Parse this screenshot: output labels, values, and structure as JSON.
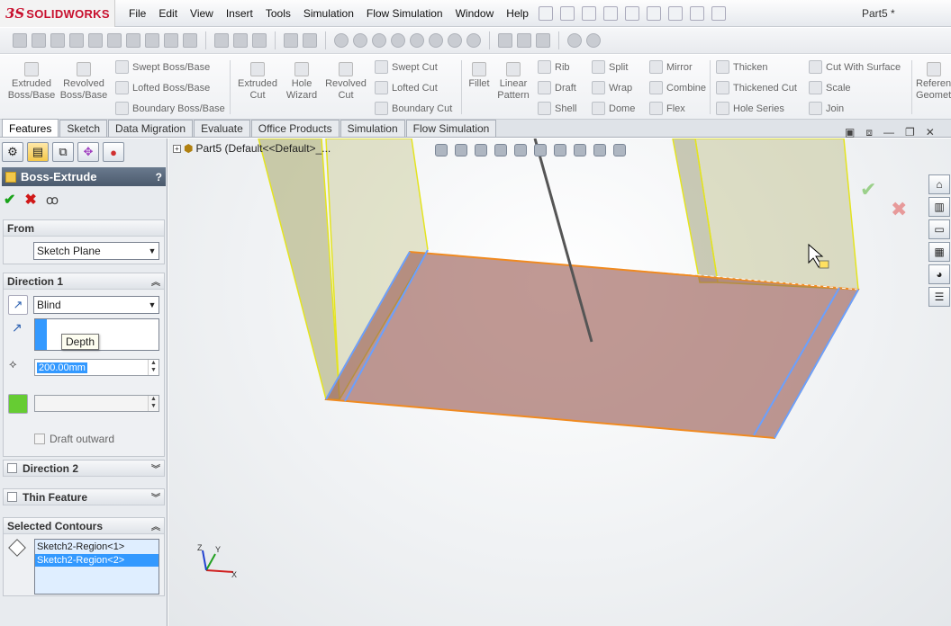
{
  "app": {
    "brand_ds": "3S",
    "brand_name": "SOLIDWORKS",
    "document_title": "Part5 *"
  },
  "menu": [
    "File",
    "Edit",
    "View",
    "Insert",
    "Tools",
    "Simulation",
    "Flow Simulation",
    "Window",
    "Help"
  ],
  "ribbon": {
    "extruded_boss": "Extruded\nBoss/Base",
    "revolved_boss": "Revolved\nBoss/Base",
    "swept_boss": "Swept Boss/Base",
    "lofted_boss": "Lofted Boss/Base",
    "boundary_boss": "Boundary Boss/Base",
    "extruded_cut": "Extruded\nCut",
    "hole_wizard": "Hole\nWizard",
    "revolved_cut": "Revolved\nCut",
    "swept_cut": "Swept Cut",
    "lofted_cut": "Lofted Cut",
    "boundary_cut": "Boundary Cut",
    "fillet": "Fillet",
    "linear_pattern": "Linear\nPattern",
    "rib": "Rib",
    "draft": "Draft",
    "shell": "Shell",
    "split": "Split",
    "wrap": "Wrap",
    "dome": "Dome",
    "mirror": "Mirror",
    "combine": "Combine",
    "flex": "Flex",
    "thicken": "Thicken",
    "thickened_cut": "Thickened Cut",
    "hole_series": "Hole Series",
    "cut_with_surface": "Cut With Surface",
    "scale": "Scale",
    "join": "Join",
    "reference_geometry": "Reference\nGeometry"
  },
  "tabs": [
    "Features",
    "Sketch",
    "Data Migration",
    "Evaluate",
    "Office Products",
    "Simulation",
    "Flow Simulation"
  ],
  "active_tab": "Features",
  "property_manager": {
    "title": "Boss-Extrude",
    "help": "?",
    "from": {
      "label": "From",
      "value": "Sketch Plane"
    },
    "direction1": {
      "label": "Direction 1",
      "end_condition": "Blind",
      "depth_tooltip": "Depth",
      "depth_value": "200.00mm",
      "draft_outward": "Draft outward"
    },
    "direction2": {
      "label": "Direction 2"
    },
    "thin_feature": {
      "label": "Thin Feature"
    },
    "selected_contours": {
      "label": "Selected Contours",
      "items": [
        "Sketch2-Region<1>",
        "Sketch2-Region<2>"
      ]
    }
  },
  "tree": {
    "root": "Part5  (Default<<Default>_..."
  },
  "triad": {
    "x": "X",
    "y": "Y",
    "z": "Z"
  },
  "colors": {
    "accent_blue": "#3399ff",
    "title_bar": "#566579",
    "brand_red": "#c8102e",
    "selection_blue": "#3399ff"
  }
}
